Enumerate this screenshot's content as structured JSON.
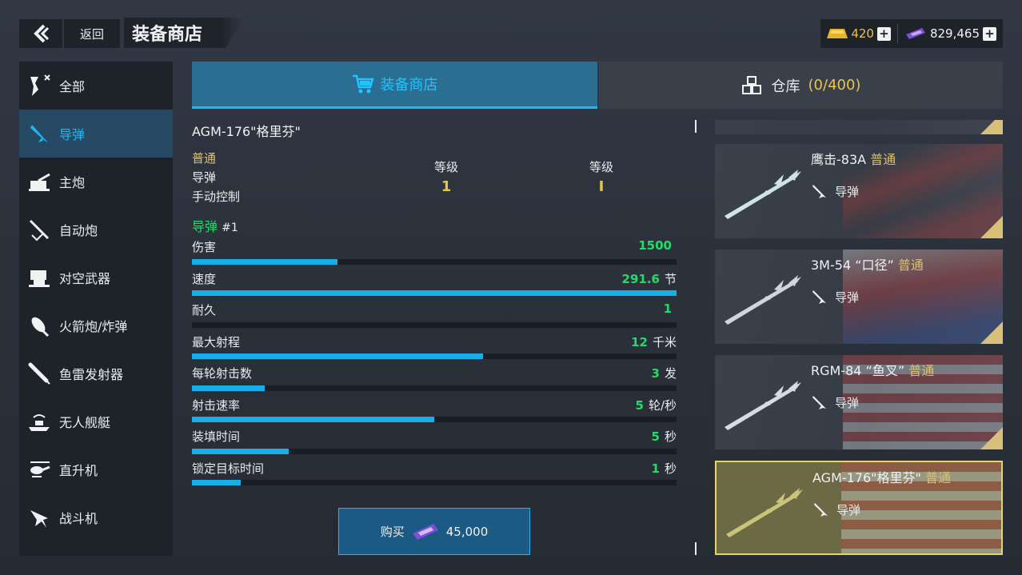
{
  "topbar": {
    "back_label": "返回",
    "title": "装备商店",
    "gold": "420",
    "gems": "829,465"
  },
  "sidebar": {
    "items": [
      {
        "label": "全部",
        "icon": "all-icon"
      },
      {
        "label": "导弹",
        "icon": "missile-icon"
      },
      {
        "label": "主炮",
        "icon": "main-gun-icon"
      },
      {
        "label": "自动炮",
        "icon": "autocannon-icon"
      },
      {
        "label": "对空武器",
        "icon": "anti-air-icon"
      },
      {
        "label": "火箭炮/炸弹",
        "icon": "rocket-icon"
      },
      {
        "label": "鱼雷发射器",
        "icon": "torpedo-icon"
      },
      {
        "label": "无人舰艇",
        "icon": "drone-boat-icon"
      },
      {
        "label": "直升机",
        "icon": "helicopter-icon"
      },
      {
        "label": "战斗机",
        "icon": "fighter-jet-icon"
      }
    ],
    "active_index": 1
  },
  "tabs": {
    "shop": "装备商店",
    "warehouse": "仓库",
    "warehouse_count": "(0/400)"
  },
  "detail": {
    "name": "AGM-176\"格里芬\"",
    "rarity": "普通",
    "type": "导弹",
    "control": "手动控制",
    "level1_label": "等级",
    "level1_value": "1",
    "level2_label": "等级",
    "level2_value": "I",
    "weapon_label": "导弹",
    "weapon_num": "#1",
    "stats": [
      {
        "label": "伤害",
        "value": "1500",
        "unit": "",
        "fill": 0.3
      },
      {
        "label": "速度",
        "value": "291.6",
        "unit": "节",
        "fill": 1.0
      },
      {
        "label": "耐久",
        "value": "1",
        "unit": "",
        "fill": 0.0
      },
      {
        "label": "最大射程",
        "value": "12",
        "unit": "千米",
        "fill": 0.6
      },
      {
        "label": "每轮射击数",
        "value": "3",
        "unit": "发",
        "fill": 0.15
      },
      {
        "label": "射击速率",
        "value": "5",
        "unit": "轮/秒",
        "fill": 0.5
      },
      {
        "label": "装填时间",
        "value": "5",
        "unit": "秒",
        "fill": 0.2
      },
      {
        "label": "锁定目标时间",
        "value": "1",
        "unit": "秒",
        "fill": 0.1
      }
    ],
    "buy_label": "购买",
    "price": "45,000"
  },
  "list": [
    {
      "name": "鹰击-83A",
      "rarity": "普通",
      "type": "导弹",
      "selected": false
    },
    {
      "name": "3M-54 “口径”",
      "rarity": "普通",
      "type": "导弹",
      "selected": false
    },
    {
      "name": "RGM-84 “鱼叉”",
      "rarity": "普通",
      "type": "导弹",
      "selected": false
    },
    {
      "name": "AGM-176\"格里芬\"",
      "rarity": "普通",
      "type": "导弹",
      "selected": true
    }
  ],
  "colors": {
    "accent": "#1fb7f0",
    "green": "#26d96b",
    "gold": "#e7c54c"
  }
}
